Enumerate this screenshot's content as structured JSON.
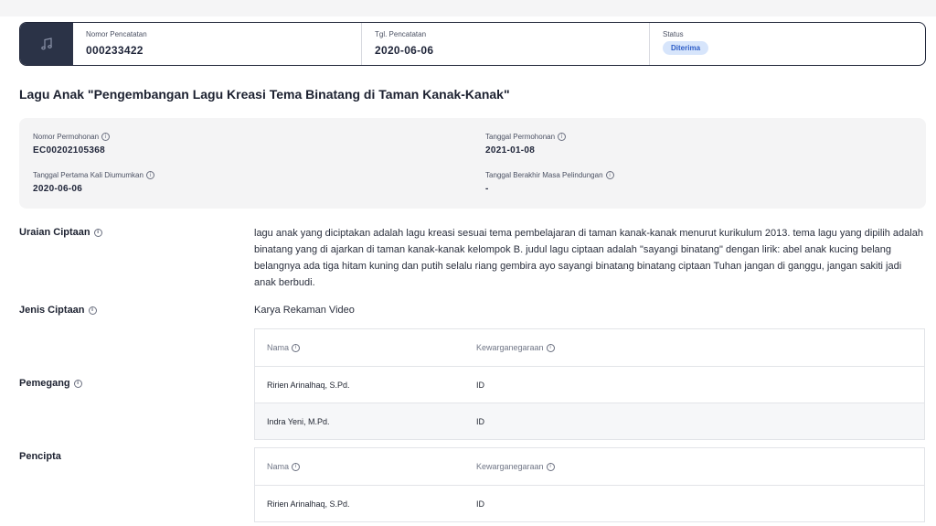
{
  "record": {
    "icon": "music-note-icon",
    "nomor_pencatatan_label": "Nomor Pencatatan",
    "nomor_pencatatan": "000233422",
    "tgl_pencatatan_label": "Tgl. Pencatatan",
    "tgl_pencatatan": "2020-06-06",
    "status_label": "Status",
    "status": "Diterima"
  },
  "title": "Lagu Anak \"Pengembangan Lagu Kreasi Tema Binatang di Taman Kanak-Kanak\"",
  "info": {
    "nomor_permohonan_label": "Nomor Permohonan",
    "nomor_permohonan": "EC00202105368",
    "tanggal_permohonan_label": "Tanggal Permohonan",
    "tanggal_permohonan": "2021-01-08",
    "tanggal_diumumkan_label": "Tanggal Pertama Kali Diumumkan",
    "tanggal_diumumkan": "2020-06-06",
    "tanggal_berakhir_label": "Tanggal Berakhir Masa Pelindungan",
    "tanggal_berakhir": "-"
  },
  "uraian": {
    "label": "Uraian Ciptaan",
    "text": "lagu anak yang diciptakan adalah lagu kreasi sesuai tema pembelajaran di taman kanak-kanak menurut kurikulum 2013. tema lagu yang dipilih adalah binatang yang di ajarkan di taman kanak-kanak kelompok B. judul lagu ciptaan adalah \"sayangi binatang\" dengan lirik: abel anak kucing belang belangnya ada tiga hitam kuning dan putih selalu riang gembira ayo sayangi binatang binatang ciptaan Tuhan jangan di ganggu, jangan sakiti jadi anak berbudi."
  },
  "jenis": {
    "label": "Jenis Ciptaan",
    "value": "Karya Rekaman Video"
  },
  "pemegang": {
    "label": "Pemegang",
    "col_nama": "Nama",
    "col_kewarganegaraan": "Kewarganegaraan",
    "rows": [
      {
        "nama": "Ririen Arinalhaq, S.Pd.",
        "kw": "ID"
      },
      {
        "nama": "Indra Yeni, M.Pd.",
        "kw": "ID"
      }
    ]
  },
  "pencipta": {
    "label": "Pencipta",
    "col_nama": "Nama",
    "col_kewarganegaraan": "Kewarganegaraan",
    "rows": [
      {
        "nama": "Ririen Arinalhaq, S.Pd.",
        "kw": "ID"
      }
    ]
  }
}
